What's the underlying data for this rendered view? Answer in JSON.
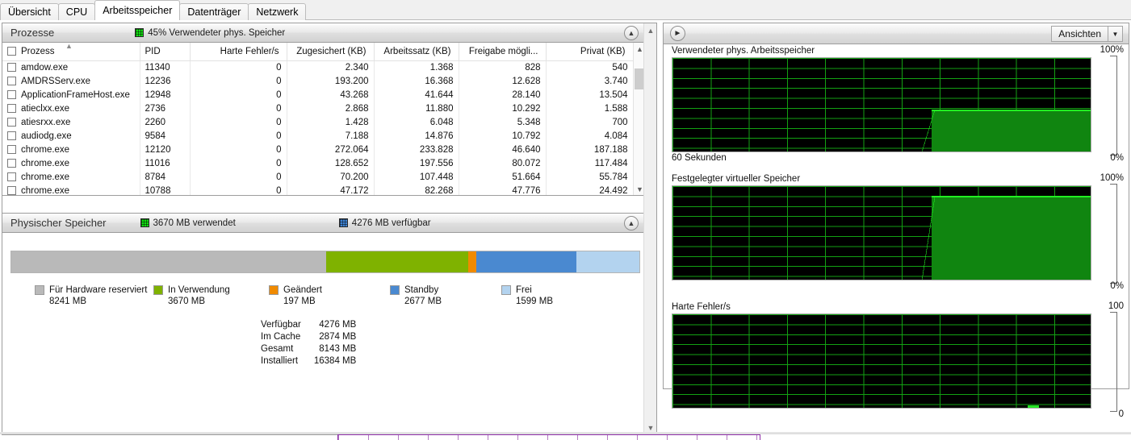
{
  "tabs": [
    {
      "label": "Übersicht",
      "active": false
    },
    {
      "label": "CPU",
      "active": false
    },
    {
      "label": "Arbeitsspeicher",
      "active": true
    },
    {
      "label": "Datenträger",
      "active": false
    },
    {
      "label": "Netzwerk",
      "active": false
    }
  ],
  "processes_section": {
    "title": "Prozesse",
    "stat_label": "45% Verwendeter phys. Speicher",
    "stat_swatch_color": "#12e012",
    "collapse_icon": "chevron-up-icon",
    "columns": [
      {
        "key": "name",
        "label": "Prozess",
        "align": "left"
      },
      {
        "key": "pid",
        "label": "PID",
        "align": "left"
      },
      {
        "key": "faults",
        "label": "Harte Fehler/s",
        "align": "right"
      },
      {
        "key": "commit",
        "label": "Zugesichert (KB)",
        "align": "right"
      },
      {
        "key": "working",
        "label": "Arbeitssatz (KB)",
        "align": "right"
      },
      {
        "key": "share",
        "label": "Freigabe mögli...",
        "align": "right"
      },
      {
        "key": "private",
        "label": "Privat (KB)",
        "align": "right"
      }
    ],
    "rows": [
      {
        "name": "amdow.exe",
        "pid": "11340",
        "faults": "0",
        "commit": "2.340",
        "working": "1.368",
        "share": "828",
        "private": "540"
      },
      {
        "name": "AMDRSServ.exe",
        "pid": "12236",
        "faults": "0",
        "commit": "193.200",
        "working": "16.368",
        "share": "12.628",
        "private": "3.740"
      },
      {
        "name": "ApplicationFrameHost.exe",
        "pid": "12948",
        "faults": "0",
        "commit": "43.268",
        "working": "41.644",
        "share": "28.140",
        "private": "13.504"
      },
      {
        "name": "atieclxx.exe",
        "pid": "2736",
        "faults": "0",
        "commit": "2.868",
        "working": "11.880",
        "share": "10.292",
        "private": "1.588"
      },
      {
        "name": "atiesrxx.exe",
        "pid": "2260",
        "faults": "0",
        "commit": "1.428",
        "working": "6.048",
        "share": "5.348",
        "private": "700"
      },
      {
        "name": "audiodg.exe",
        "pid": "9584",
        "faults": "0",
        "commit": "7.188",
        "working": "14.876",
        "share": "10.792",
        "private": "4.084"
      },
      {
        "name": "chrome.exe",
        "pid": "12120",
        "faults": "0",
        "commit": "272.064",
        "working": "233.828",
        "share": "46.640",
        "private": "187.188"
      },
      {
        "name": "chrome.exe",
        "pid": "11016",
        "faults": "0",
        "commit": "128.652",
        "working": "197.556",
        "share": "80.072",
        "private": "117.484"
      },
      {
        "name": "chrome.exe",
        "pid": "8784",
        "faults": "0",
        "commit": "70.200",
        "working": "107.448",
        "share": "51.664",
        "private": "55.784"
      },
      {
        "name": "chrome.exe",
        "pid": "10788",
        "faults": "0",
        "commit": "47.172",
        "working": "82.268",
        "share": "47.776",
        "private": "24.492"
      }
    ]
  },
  "physical_memory_section": {
    "title": "Physischer Speicher",
    "used_label": "3670 MB verwendet",
    "available_label": "4276 MB verfügbar",
    "used_swatch_color": "#12e012",
    "available_swatch_color": "#3f84d4",
    "collapse_icon": "chevron-up-icon",
    "bar_segments": [
      {
        "name": "hardware_reserved",
        "color": "#b9b9b9",
        "percent": 50.1
      },
      {
        "name": "in_use",
        "color": "#7fb200",
        "percent": 22.7
      },
      {
        "name": "modified",
        "color": "#f08a00",
        "percent": 1.2
      },
      {
        "name": "standby",
        "color": "#4a89d0",
        "percent": 16.0
      },
      {
        "name": "free",
        "color": "#b3d3ef",
        "percent": 10.0
      }
    ],
    "legend": [
      {
        "label": "Für Hardware reserviert",
        "value": "8241 MB",
        "color": "#b9b9b9"
      },
      {
        "label": "In Verwendung",
        "value": "3670 MB",
        "color": "#7fb200"
      },
      {
        "label": "Geändert",
        "value": "197 MB",
        "color": "#f08a00"
      },
      {
        "label": "Standby",
        "value": "2677 MB",
        "color": "#4a89d0"
      },
      {
        "label": "Frei",
        "value": "1599 MB",
        "color": "#b3d3ef"
      }
    ],
    "stats": [
      {
        "label": "Verfügbar",
        "value": "4276 MB"
      },
      {
        "label": "Im Cache",
        "value": "2874 MB"
      },
      {
        "label": "Gesamt",
        "value": "8143 MB"
      },
      {
        "label": "Installiert",
        "value": "16384 MB"
      }
    ]
  },
  "right_panel": {
    "expand_icon": "chevron-right-circle-icon",
    "views_label": "Ansichten",
    "views_arrow_icon": "chevron-down-icon",
    "timescale_label": "60 Sekunden",
    "graphs": [
      {
        "title": "Verwendeter phys. Arbeitsspeicher",
        "max_label": "100%",
        "min_label": "0%",
        "has_timescale": true
      },
      {
        "title": "Festgelegter virtueller Speicher",
        "max_label": "100%",
        "min_label": "0%",
        "has_timescale": false
      },
      {
        "title": "Harte Fehler/s",
        "max_label": "100",
        "min_label": "0",
        "has_timescale": false
      }
    ]
  },
  "chart_data": [
    {
      "type": "area",
      "title": "Verwendeter phys. Arbeitsspeicher",
      "ylabel": "",
      "xlabel": "60 Sekunden",
      "ylim": [
        0,
        100
      ],
      "ytick_labels": [
        "0%",
        "100%"
      ],
      "grid": true,
      "line_color": "#22ee22",
      "fill_color": "#108510",
      "background": "#000000",
      "x": [
        0,
        10,
        20,
        30,
        40,
        50,
        58,
        60,
        62,
        64,
        70,
        76,
        80,
        86,
        90,
        94,
        100
      ],
      "values": [
        0,
        0,
        0,
        0,
        0,
        0,
        0,
        0,
        30,
        44,
        45,
        46,
        45,
        46,
        45,
        46,
        45
      ]
    },
    {
      "type": "area",
      "title": "Festgelegter virtueller Speicher",
      "ylabel": "",
      "xlabel": "",
      "ylim": [
        0,
        100
      ],
      "ytick_labels": [
        "0%",
        "100%"
      ],
      "grid": true,
      "line_color": "#22ee22",
      "fill_color": "#108510",
      "background": "#000000",
      "x": [
        0,
        10,
        20,
        30,
        40,
        50,
        58,
        60,
        62,
        64,
        70,
        76,
        80,
        86,
        90,
        94,
        100
      ],
      "values": [
        0,
        0,
        0,
        0,
        0,
        0,
        0,
        0,
        60,
        89,
        90,
        91,
        90,
        91,
        90,
        91,
        90
      ]
    },
    {
      "type": "area",
      "title": "Harte Fehler/s",
      "ylabel": "",
      "xlabel": "",
      "ylim": [
        0,
        100
      ],
      "ytick_labels": [
        "0",
        "100"
      ],
      "grid": true,
      "line_color": "#25e425",
      "fill_color": "#108510",
      "background": "#000000",
      "x": [
        0,
        50,
        85,
        87,
        89,
        100
      ],
      "values": [
        0,
        0,
        0,
        2,
        0,
        0
      ]
    }
  ]
}
